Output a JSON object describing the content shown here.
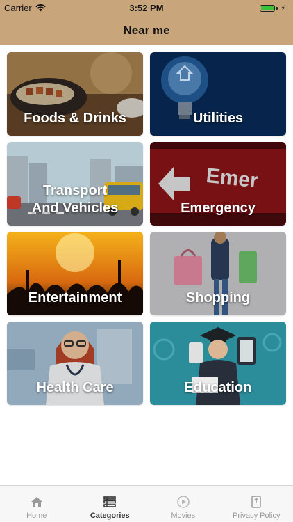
{
  "status_bar": {
    "carrier": "Carrier",
    "time": "3:52 PM",
    "battery_level": 1.0
  },
  "nav": {
    "title": "Near me",
    "color": "#c8a57a"
  },
  "categories": [
    {
      "label": "Foods & Drinks"
    },
    {
      "label": "Utilities"
    },
    {
      "label": "Transport\nAnd Vehicles"
    },
    {
      "label": "Emergency"
    },
    {
      "label": "Entertainment"
    },
    {
      "label": "Shopping"
    },
    {
      "label": "Health Care"
    },
    {
      "label": "Education"
    }
  ],
  "tabs": [
    {
      "label": "Home",
      "icon": "home-icon",
      "active": false
    },
    {
      "label": "Categories",
      "icon": "list-icon",
      "active": true
    },
    {
      "label": "Movies",
      "icon": "play-icon",
      "active": false
    },
    {
      "label": "Privacy Policy",
      "icon": "document-icon",
      "active": false
    }
  ]
}
